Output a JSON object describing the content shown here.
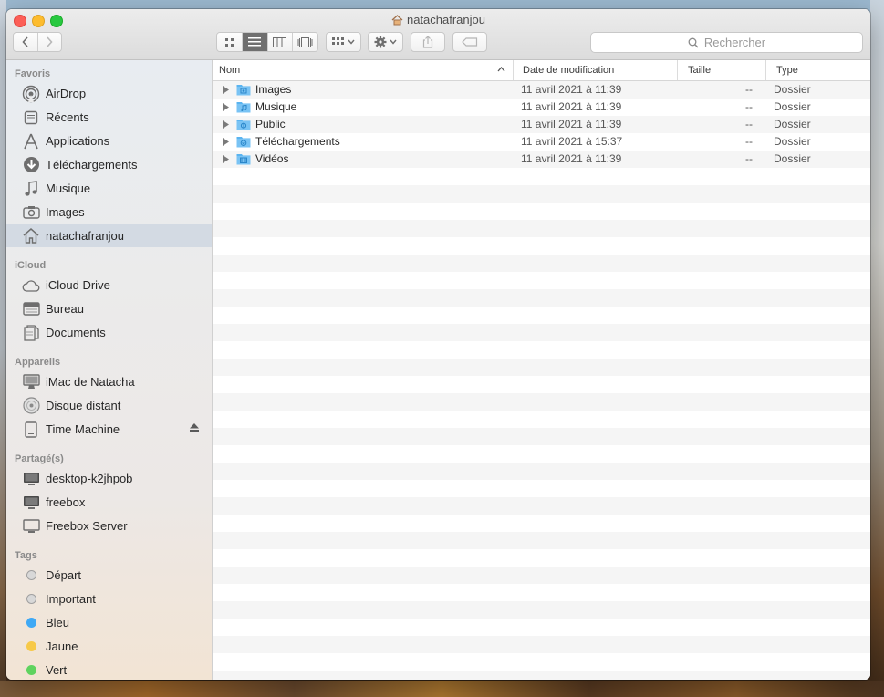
{
  "window": {
    "title": "natachafranjou"
  },
  "search": {
    "placeholder": "Rechercher"
  },
  "sidebar": {
    "sections": [
      {
        "label": "Favoris",
        "items": [
          {
            "label": "AirDrop",
            "icon": "airdrop-icon"
          },
          {
            "label": "Récents",
            "icon": "recents-icon"
          },
          {
            "label": "Applications",
            "icon": "applications-icon"
          },
          {
            "label": "Téléchargements",
            "icon": "downloads-icon"
          },
          {
            "label": "Musique",
            "icon": "music-icon"
          },
          {
            "label": "Images",
            "icon": "camera-icon"
          },
          {
            "label": "natachafranjou",
            "icon": "home-icon",
            "selected": true
          }
        ]
      },
      {
        "label": "iCloud",
        "items": [
          {
            "label": "iCloud Drive",
            "icon": "cloud-icon"
          },
          {
            "label": "Bureau",
            "icon": "desktop-icon"
          },
          {
            "label": "Documents",
            "icon": "document-icon"
          }
        ]
      },
      {
        "label": "Appareils",
        "items": [
          {
            "label": "iMac de Natacha",
            "icon": "imac-icon"
          },
          {
            "label": "Disque distant",
            "icon": "disc-icon"
          },
          {
            "label": "Time Machine",
            "icon": "drive-icon",
            "eject": true
          }
        ]
      },
      {
        "label": "Partagé(s)",
        "items": [
          {
            "label": "desktop-k2jhpob",
            "icon": "monitor-icon"
          },
          {
            "label": "freebox",
            "icon": "monitor-icon"
          },
          {
            "label": "Freebox Server",
            "icon": "monitor-icon"
          }
        ]
      },
      {
        "label": "Tags",
        "items": [
          {
            "label": "Départ",
            "color": "#d0d0d0"
          },
          {
            "label": "Important",
            "color": "#d0d0d0"
          },
          {
            "label": "Bleu",
            "color": "#3fa9f5"
          },
          {
            "label": "Jaune",
            "color": "#f7c948"
          },
          {
            "label": "Vert",
            "color": "#5fd35f"
          }
        ]
      }
    ]
  },
  "columns": {
    "name": "Nom",
    "date": "Date de modification",
    "size": "Taille",
    "kind": "Type"
  },
  "files": [
    {
      "name": "Images",
      "date": "11 avril 2021 à 11:39",
      "size": "--",
      "kind": "Dossier"
    },
    {
      "name": "Musique",
      "date": "11 avril 2021 à 11:39",
      "size": "--",
      "kind": "Dossier"
    },
    {
      "name": "Public",
      "date": "11 avril 2021 à 11:39",
      "size": "--",
      "kind": "Dossier"
    },
    {
      "name": "Téléchargements",
      "date": "11 avril 2021 à 15:37",
      "size": "--",
      "kind": "Dossier"
    },
    {
      "name": "Vidéos",
      "date": "11 avril 2021 à 11:39",
      "size": "--",
      "kind": "Dossier"
    }
  ],
  "colors": {
    "accent": "#3fa9f5",
    "selection": "#d3dae3",
    "folder": "#5ab4f0"
  }
}
